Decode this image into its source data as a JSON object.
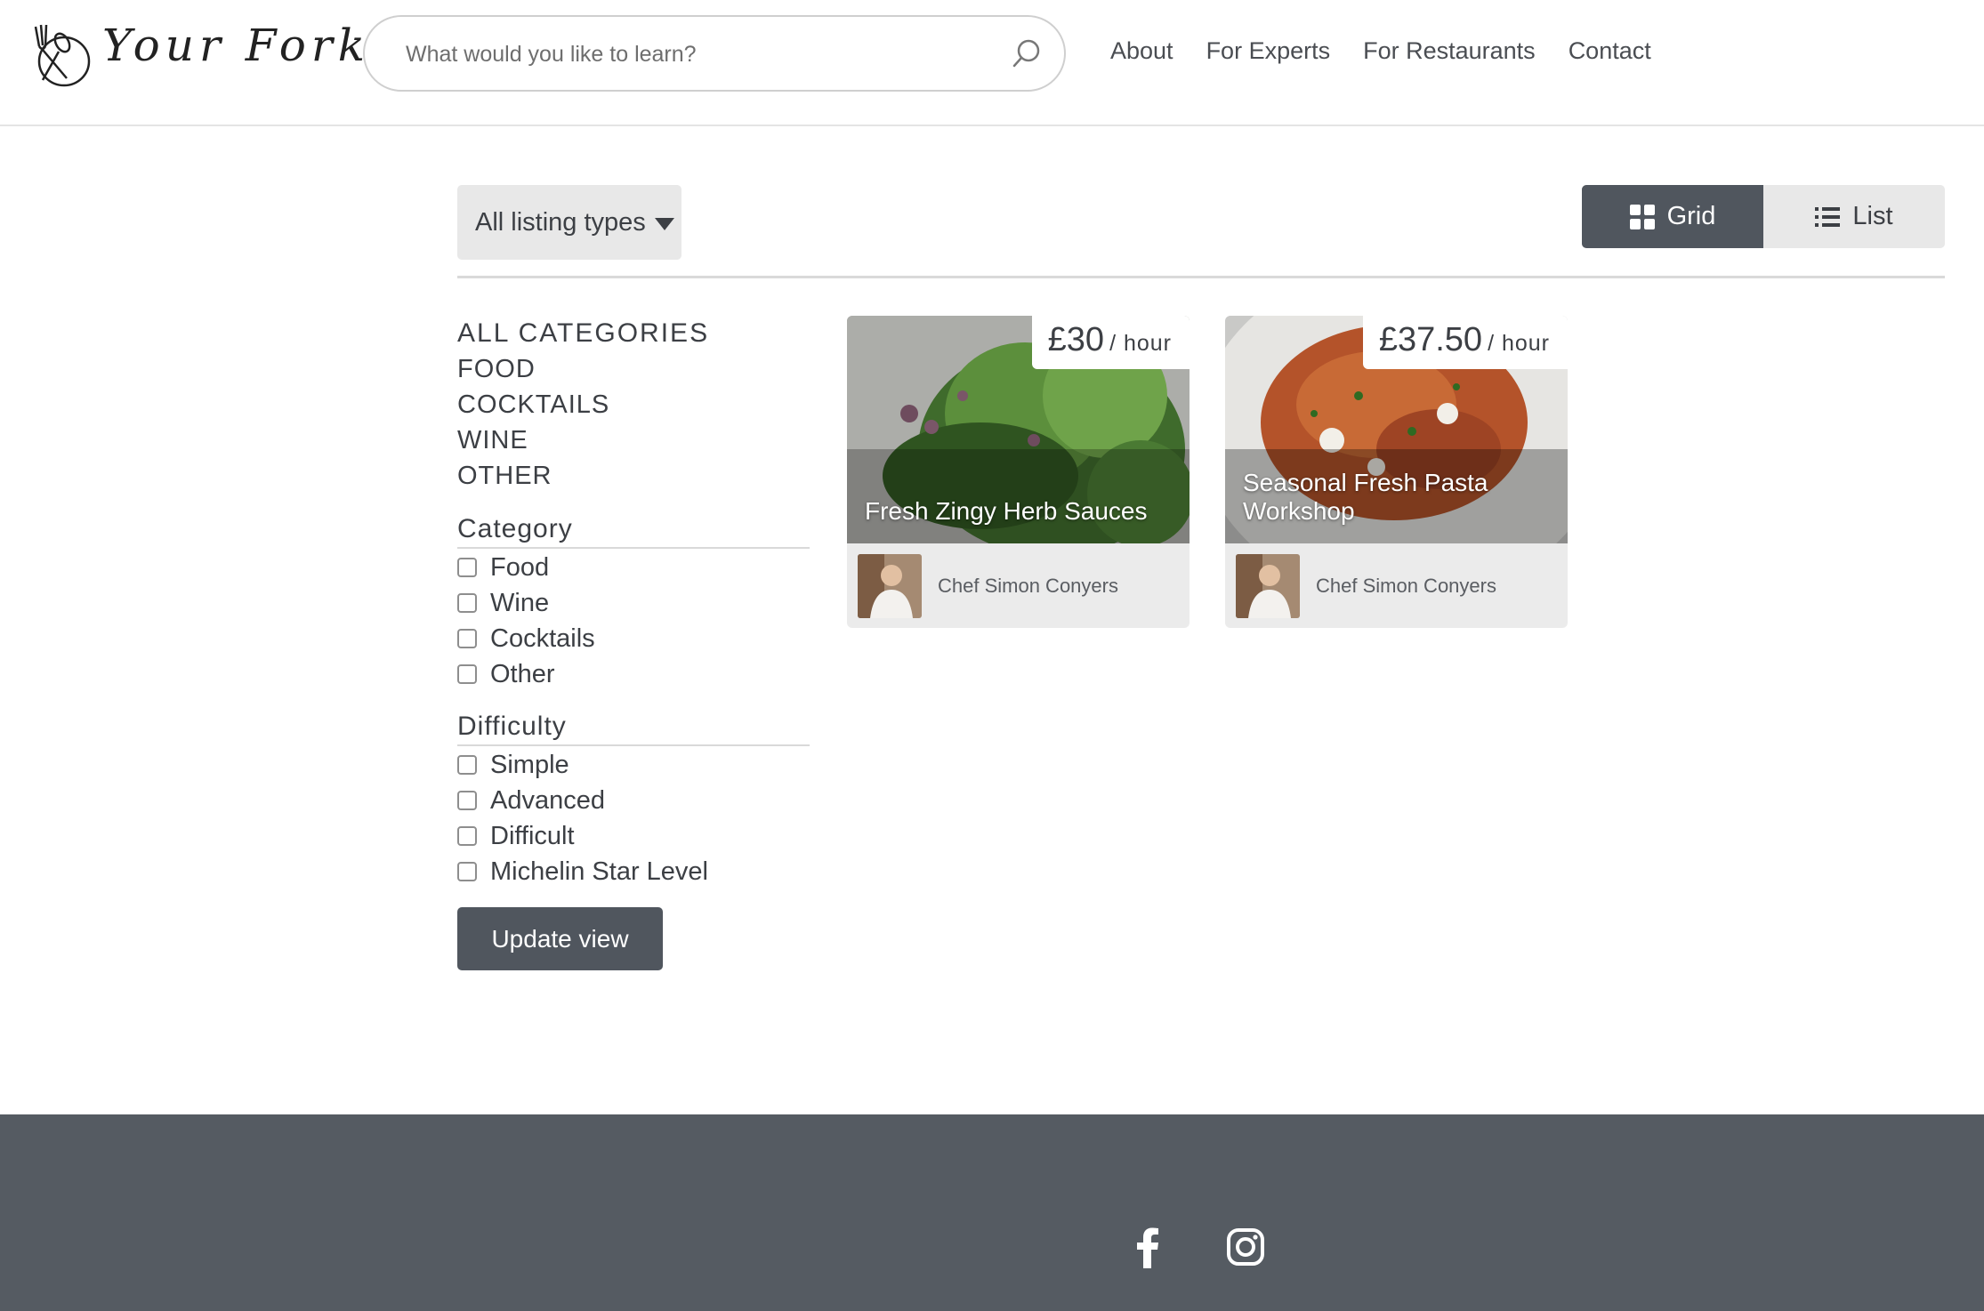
{
  "header": {
    "logo_text": "Your Fork",
    "search_placeholder": "What would you like to learn?",
    "nav": [
      "About",
      "For Experts",
      "For Restaurants",
      "Contact"
    ]
  },
  "toolbar": {
    "listing_type": "All listing types",
    "view_grid": "Grid",
    "view_list": "List",
    "active_view": "Grid"
  },
  "sidebar": {
    "category_links": [
      "ALL CATEGORIES",
      "FOOD",
      "COCKTAILS",
      "WINE",
      "OTHER"
    ],
    "category_filter": {
      "heading": "Category",
      "options": [
        "Food",
        "Wine",
        "Cocktails",
        "Other"
      ]
    },
    "difficulty_filter": {
      "heading": "Difficulty",
      "options": [
        "Simple",
        "Advanced",
        "Difficult",
        "Michelin Star Level"
      ]
    },
    "update_button": "Update view"
  },
  "listings": [
    {
      "title": "Fresh Zingy Herb Sauces",
      "price": "£30",
      "unit": "/ hour",
      "author": "Chef Simon Conyers",
      "image": "herbs-photo"
    },
    {
      "title": "Seasonal Fresh Pasta Workshop",
      "price": "£37.50",
      "unit": "/ hour",
      "author": "Chef Simon Conyers",
      "image": "pasta-photo"
    }
  ],
  "footer": {
    "social_icons": [
      "facebook-icon",
      "instagram-icon"
    ]
  },
  "colors": {
    "dark_button": "#50565e",
    "footer": "#555b62",
    "light_panel": "#e8e8e8",
    "text": "#3c3f44"
  }
}
